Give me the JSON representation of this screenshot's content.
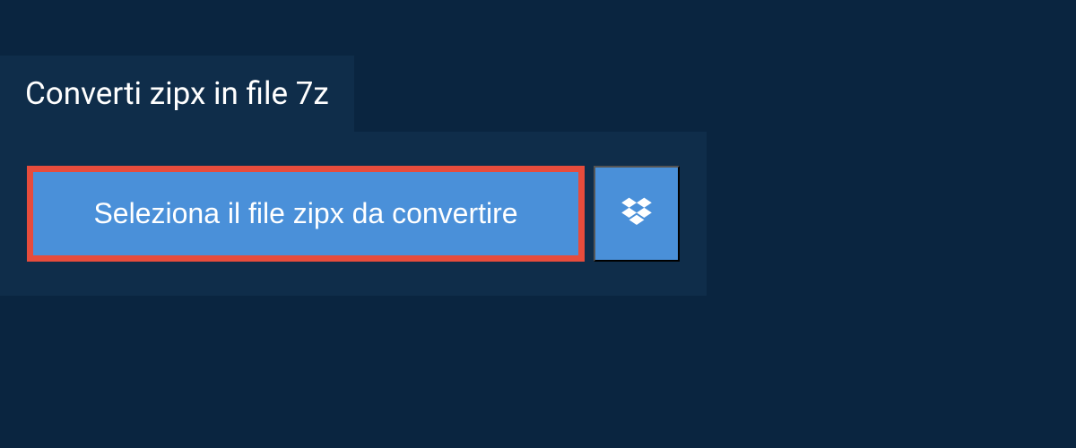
{
  "header": {
    "title": "Converti zipx in file 7z"
  },
  "upload": {
    "select_button_label": "Seleziona il file zipx da convertire"
  }
}
